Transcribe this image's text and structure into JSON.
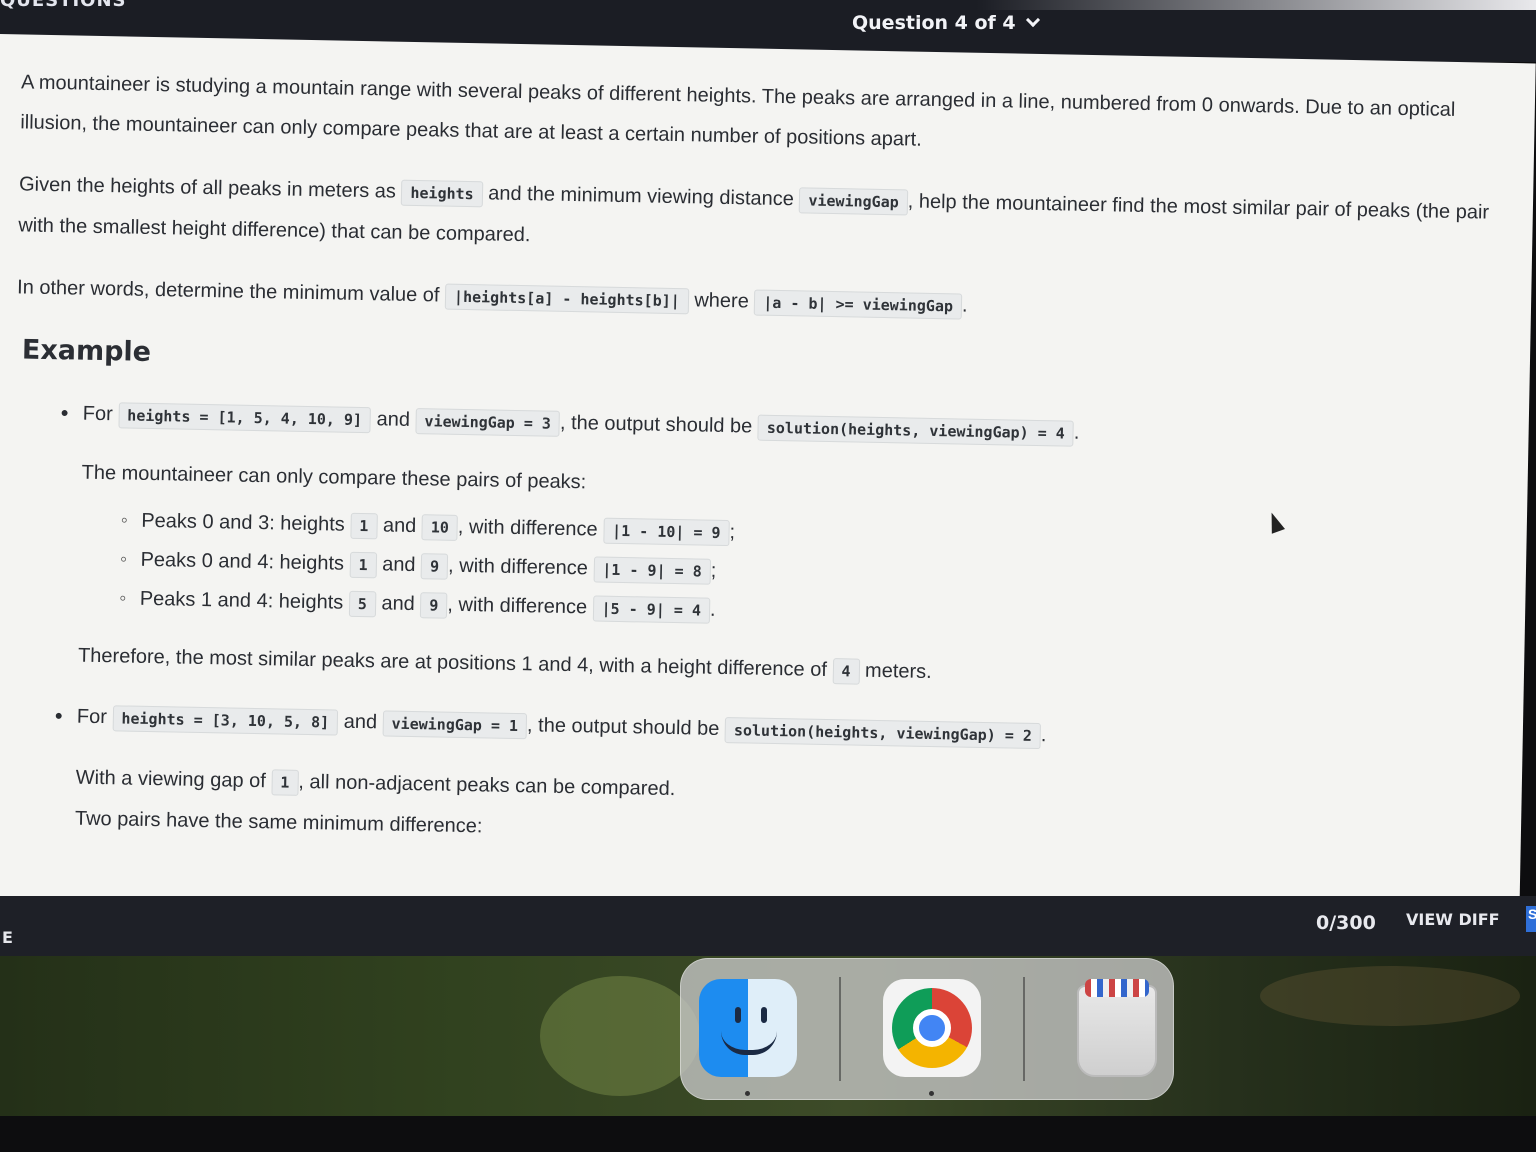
{
  "header": {
    "cut_title": "QUESTIONS",
    "question_selector": "Question 4 of 4"
  },
  "problem": {
    "p1": "A mountaineer is studying a mountain range with several peaks of different heights. The peaks are arranged in a line, numbered from 0 onwards. Due to an optical illusion, the mountaineer can only compare peaks that are at least a certain number of positions apart.",
    "p2_a": "Given the heights of all peaks in meters as",
    "p2_code1": "heights",
    "p2_b": "and the minimum viewing distance",
    "p2_code2": "viewingGap",
    "p2_c": ", help the mountaineer find the most similar pair of peaks (the pair with the smallest height difference) that can be compared.",
    "p3_a": "In other words, determine the minimum value of",
    "p3_code1": "|heights[a] - heights[b]|",
    "p3_b": "where",
    "p3_code2": "|a - b| >= viewingGap",
    "p3_c": "."
  },
  "example": {
    "heading": "Example",
    "ex1": {
      "for": "For",
      "code_heights": "heights = [1, 5, 4, 10, 9]",
      "and": "and",
      "code_gap": "viewingGap = 3",
      "output_text": ", the output should be",
      "code_solution": "solution(heights, viewingGap) = 4",
      "end": ".",
      "intro": "The mountaineer can only compare these pairs of peaks:",
      "pairs": [
        {
          "label": "Peaks 0 and 3: heights",
          "h1": "1",
          "and": "and",
          "h2": "10",
          "with": ", with difference",
          "diff": "|1 - 10| = 9",
          "end": ";"
        },
        {
          "label": "Peaks 0 and 4: heights",
          "h1": "1",
          "and": "and",
          "h2": "9",
          "with": ", with difference",
          "diff": "|1 - 9| = 8",
          "end": ";"
        },
        {
          "label": "Peaks 1 and 4: heights",
          "h1": "5",
          "and": "and",
          "h2": "9",
          "with": ", with difference",
          "diff": "|5 - 9| = 4",
          "end": "."
        }
      ],
      "conclusion_a": "Therefore, the most similar peaks are at positions 1 and 4, with a height difference of",
      "conclusion_code": "4",
      "conclusion_b": "meters."
    },
    "ex2": {
      "for": "For",
      "code_heights": "heights = [3, 10, 5, 8]",
      "and": "and",
      "code_gap": "viewingGap = 1",
      "output_text": ", the output should be",
      "code_solution": "solution(heights, viewingGap) = 2",
      "end": ".",
      "line1_a": "With a viewing gap of",
      "line1_code": "1",
      "line1_b": ", all non-adjacent peaks can be compared.",
      "line2": "Two pairs have the same minimum difference:"
    }
  },
  "footer": {
    "left_fragment": "E",
    "counter": "0/300",
    "view_diff": "VIEW DIFF",
    "edge_button": "S"
  },
  "dock": {
    "apps": [
      "finder-icon",
      "chrome-icon",
      "trash-icon"
    ]
  }
}
